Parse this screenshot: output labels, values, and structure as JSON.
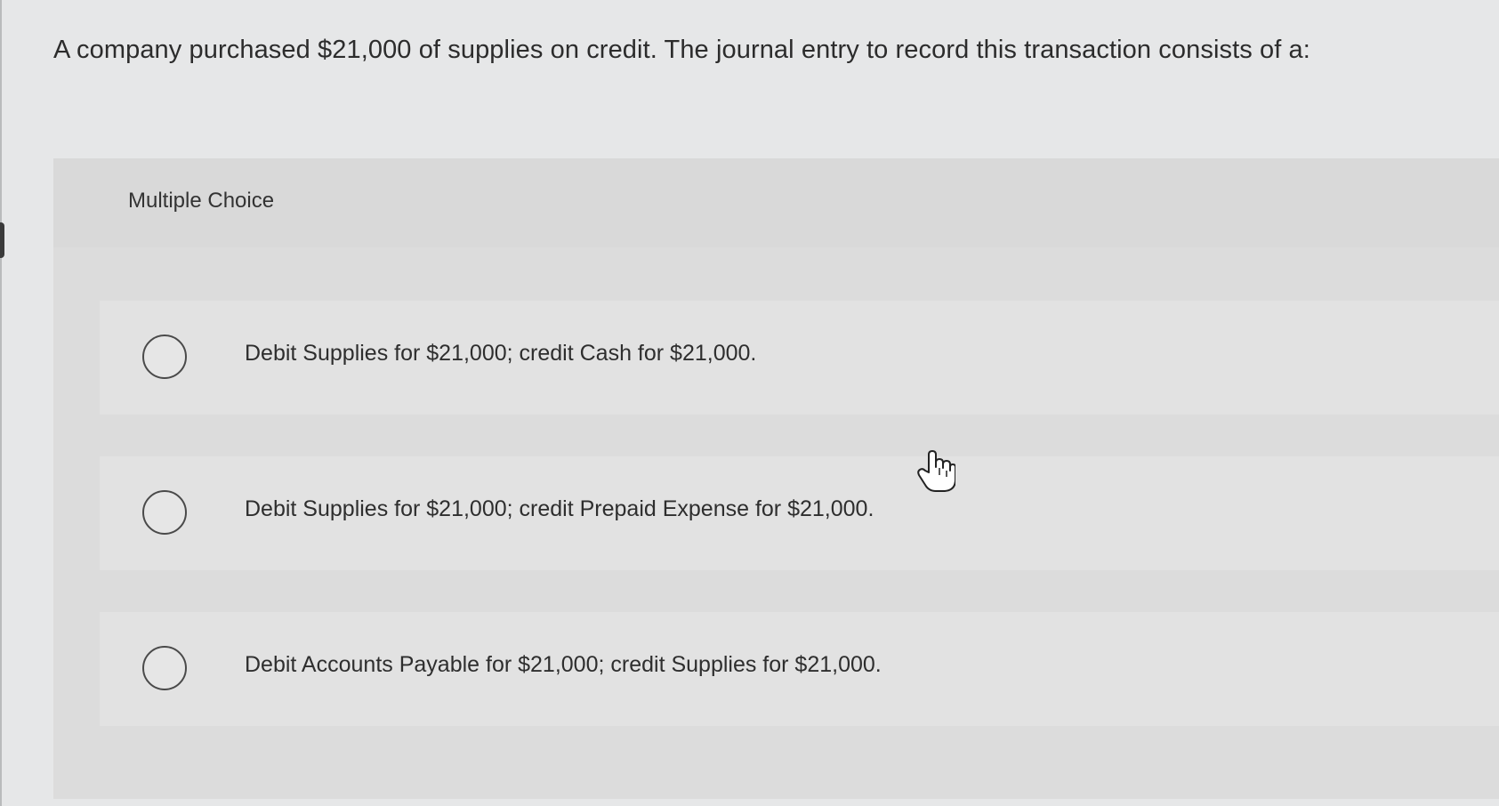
{
  "question": {
    "text": "A company purchased $21,000 of supplies on credit. The journal entry to record this transaction consists of a:"
  },
  "multiple_choice": {
    "title": "Multiple Choice",
    "options": [
      {
        "label": "Debit Supplies for $21,000; credit Cash for $21,000.",
        "selected": false
      },
      {
        "label": "Debit Supplies for $21,000; credit Prepaid Expense for $21,000.",
        "selected": false
      },
      {
        "label": "Debit Accounts Payable for $21,000; credit Supplies for $21,000.",
        "selected": false
      }
    ]
  },
  "icons": {
    "radio": "radio-button-icon",
    "cursor": "hand-pointer-icon"
  },
  "colors": {
    "background": "#e6e7e8",
    "panel": "#dcdcdc",
    "option_background": "#e2e2e2",
    "text": "#2b2b2b",
    "radio_border": "#4a4a4a"
  }
}
